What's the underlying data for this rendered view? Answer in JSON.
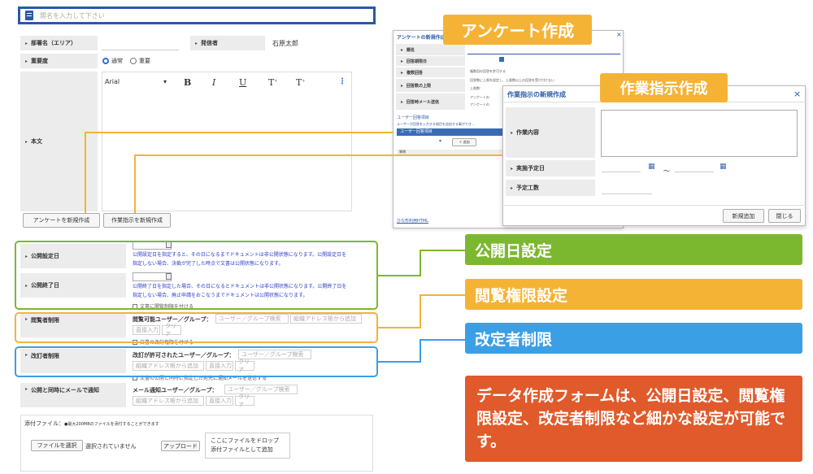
{
  "form": {
    "title_placeholder": "題名を入力して下さい",
    "dept_label": "部署名（エリア）",
    "sender_label": "発信者",
    "sender_value": "石原太郎",
    "importance_label": "重要度",
    "importance_normal": "通常",
    "importance_high": "重要",
    "body_label": "本文",
    "font_name": "Arial",
    "toolbar": {
      "bold": "B",
      "italic": "I",
      "underline": "U",
      "superscript": "T",
      "subscript": "T",
      "more": "⋮"
    },
    "create_survey_button": "アンケートを新規作成",
    "create_task_button": "作業指示を新規作成",
    "publish_start_label": "公開設定日",
    "publish_start_note_1": "公開設定日を指定すると、その日になるまでドキュメントは非公開状態になります。公開設定日を",
    "publish_start_note_2": "指定しない場合、決裁が完了した時点で文書は公開状態になります。",
    "publish_end_label": "公開終了日",
    "publish_end_note_1": "公開終了日を指定した場合、その日になるとドキュメントは非公開状態になります。公開終了日を",
    "publish_end_note_2": "指定しない場合、廃止申請をおこなうまでドキュメントは公開状態になります。",
    "publish_end_check": "文書に閲覧制限を付ける",
    "view_label": "閲覧者制限",
    "view_users_label": "閲覧可能ユーザー／グループ：",
    "user_group_search": "ユーザー／グループ検索",
    "address_book_add": "組織アドレス帳から追加",
    "direct_input": "直接入力",
    "clear": "クリア",
    "view_check": "文書の改訂権限を付ける",
    "edit_label": "改訂者制限",
    "edit_users_label": "改訂が許可されたユーザー／グループ：",
    "edit_check": "文書の公開と同時に指定した宛先に通知メールを送信する",
    "notify_label": "公開と同時にメールで通知",
    "notify_users_label": "メール通知ユーザー／グループ：",
    "attach_label": "添付ファイル：",
    "attach_note": "●最大200MBのファイルを添付することができます",
    "choose_file": "ファイルを選択",
    "no_file": "選択されていません",
    "upload": "アップロード",
    "drop_line_1": "ここにファイルをドロップ",
    "drop_line_2": "添付ファイルとして追加"
  },
  "survey_dialog": {
    "title": "アンケートの新規作成",
    "q_label": "題名",
    "deadline_label": "回答期限日",
    "multi_label": "複数回答",
    "limit_label": "回答数の上限",
    "mail_label": "回答時メール送信",
    "opt_multi": "複数回の回答を許可する",
    "opt_limit": "回答数に上限を設定し、上限数以上の回答を受け付けない",
    "limit_count": "上限数：",
    "opt_mail_1": "アンケートの",
    "opt_mail_2": "アンケートの",
    "user_items_title": "ユーザー回答項目",
    "user_items_note": "ユーザーが回答を入力する項目を追加する事ができ…",
    "user_items_bar": "ユーザー回答項目",
    "add": "＋ 追加",
    "col": "質問",
    "footer_link": "ひな形利用HTML"
  },
  "task_dialog": {
    "title": "作業指示の新規作成",
    "content_label": "作業内容",
    "date_label": "実施予定日",
    "range_sep": "～",
    "effort_label": "予定工数",
    "add_button": "新規追加",
    "close_button": "閉じる",
    "close_icon": "×"
  },
  "callouts": {
    "survey": "アンケート作成",
    "task": "作業指示作成",
    "publish": "公開日設定",
    "view": "閲覧権限設定",
    "edit": "改定者制限",
    "summary": "データ作成フォームは、公開日設定、閲覧権限設定、改定者制限など細かな設定が可能です。"
  },
  "colors": {
    "survey_orange": "#f5b335",
    "publish_green": "#7cb82f",
    "view_yellow": "#f5b335",
    "edit_blue": "#3b9fe6",
    "summary_red": "#e05a2b",
    "title_border": "#2b58a8"
  }
}
